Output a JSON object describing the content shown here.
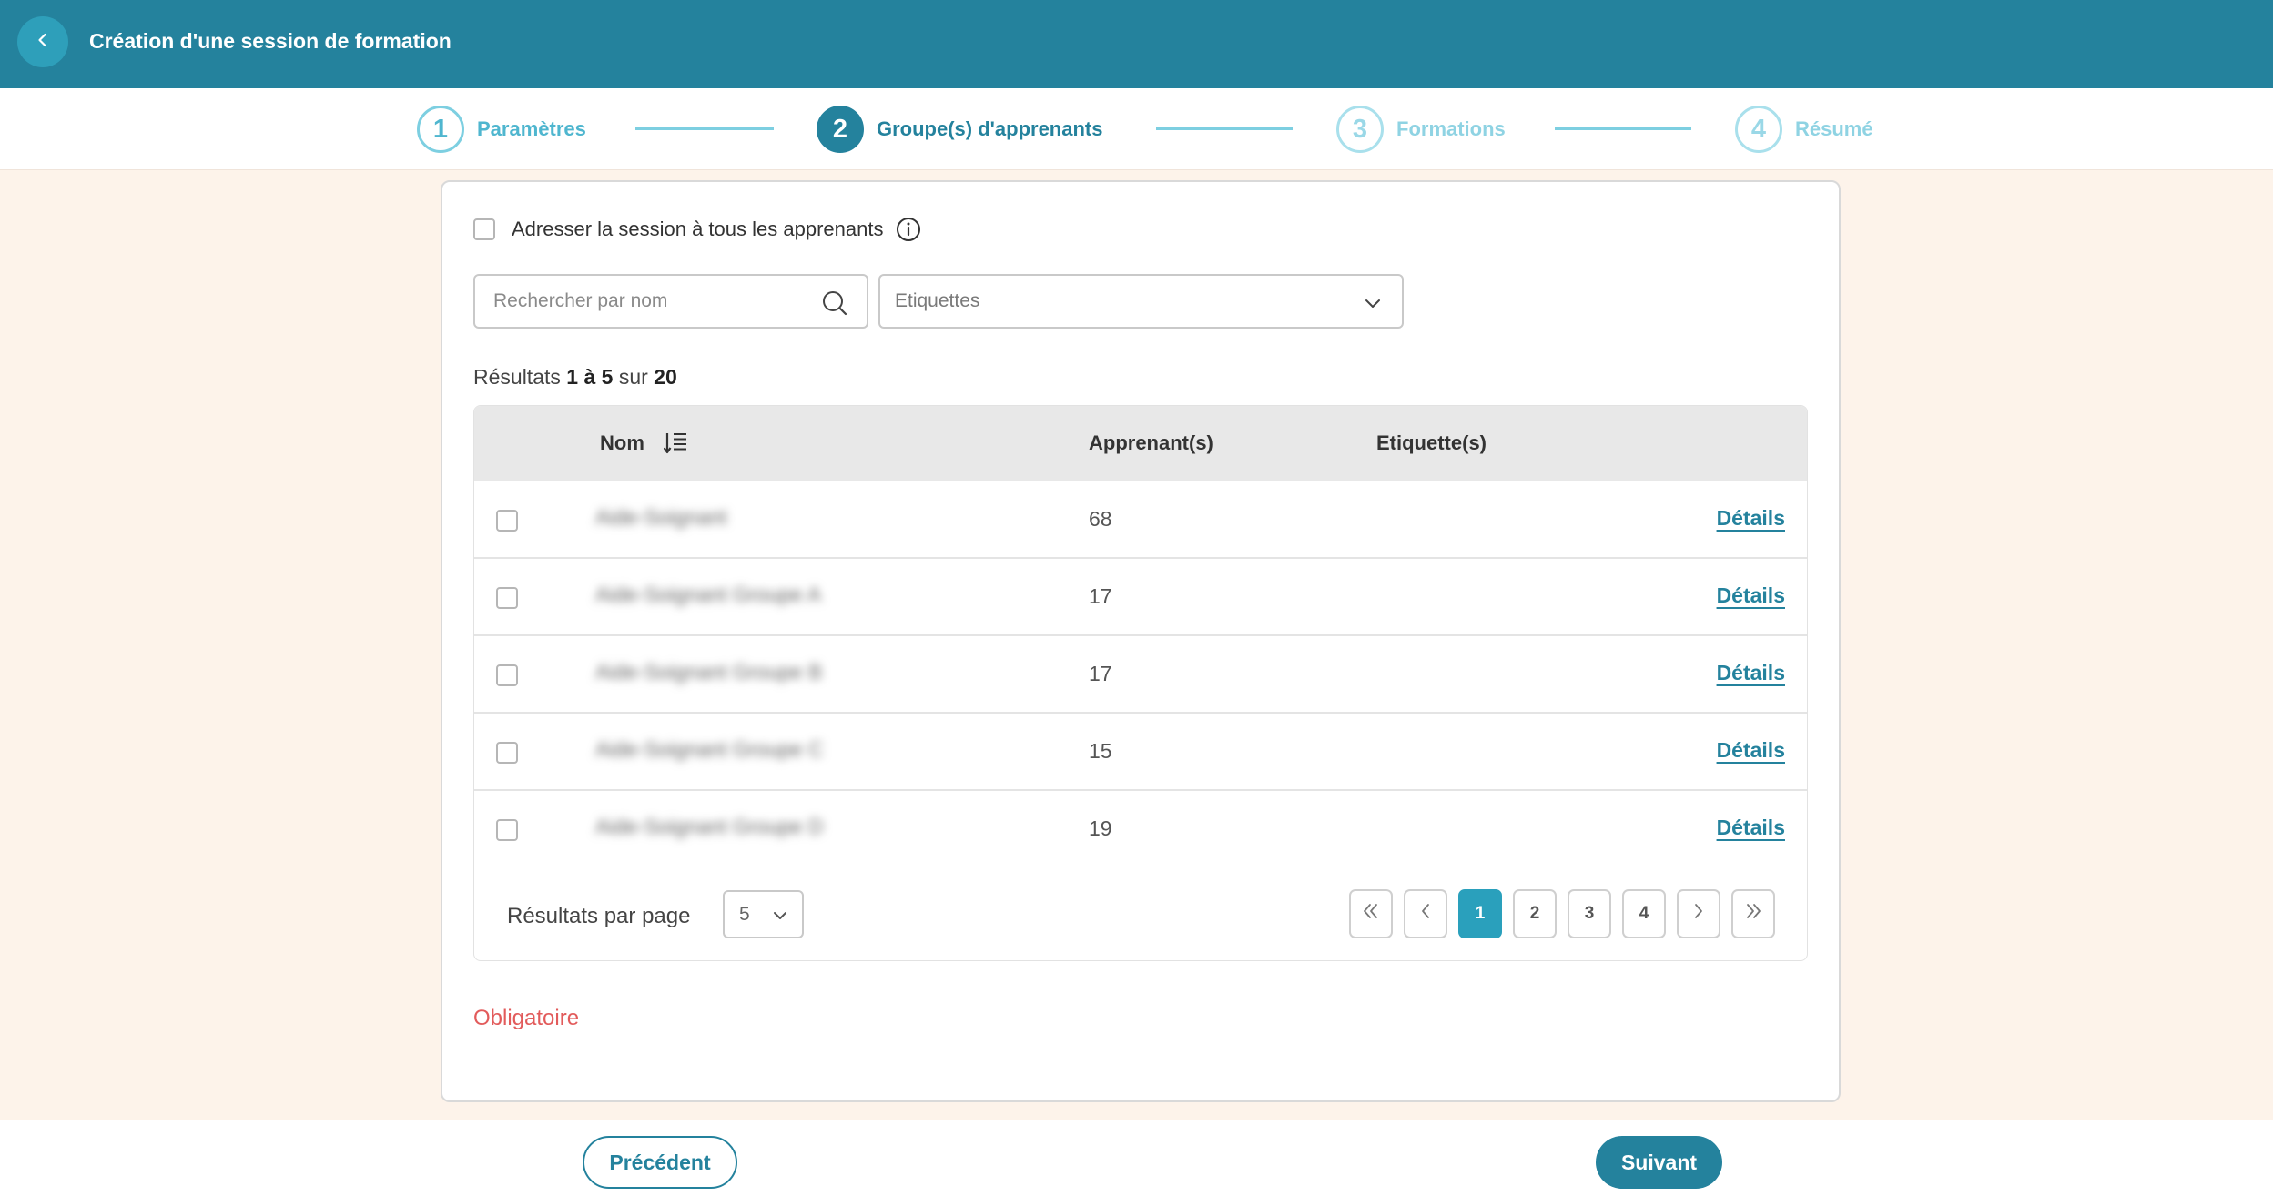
{
  "header": {
    "title": "Création d'une session de formation",
    "back_icon": "chevron-left-icon"
  },
  "stepper": {
    "steps": [
      {
        "number": "1",
        "label": "Paramètres",
        "state": "done"
      },
      {
        "number": "2",
        "label": "Groupe(s) d'apprenants",
        "state": "active"
      },
      {
        "number": "3",
        "label": "Formations",
        "state": "todo"
      },
      {
        "number": "4",
        "label": "Résumé",
        "state": "todo"
      }
    ]
  },
  "form": {
    "all_learners_label": "Adresser la session à tous les apprenants",
    "all_learners_checked": false,
    "search_placeholder": "Rechercher par nom",
    "search_value": "",
    "tags_placeholder": "Etiquettes",
    "results": {
      "prefix": "Résultats",
      "range": "1 à 5",
      "middle": "sur",
      "total": "20"
    },
    "required_message": "Obligatoire"
  },
  "table": {
    "headers": {
      "name": "Nom",
      "learners": "Apprenant(s)",
      "tags": "Etiquette(s)"
    },
    "rows": [
      {
        "name": "Aide-Soignant",
        "learners": "68",
        "tags": "",
        "action": "Détails"
      },
      {
        "name": "Aide-Soignant Groupe A",
        "learners": "17",
        "tags": "",
        "action": "Détails"
      },
      {
        "name": "Aide-Soignant Groupe B",
        "learners": "17",
        "tags": "",
        "action": "Détails"
      },
      {
        "name": "Aide-Soignant Groupe C",
        "learners": "15",
        "tags": "",
        "action": "Détails"
      },
      {
        "name": "Aide-Soignant Groupe D",
        "learners": "19",
        "tags": "",
        "action": "Détails"
      }
    ],
    "per_page_label": "Résultats par page",
    "per_page_value": "5",
    "pages": [
      "1",
      "2",
      "3",
      "4"
    ],
    "current_page": "1"
  },
  "footer": {
    "prev_label": "Précédent",
    "next_label": "Suivant"
  },
  "colors": {
    "primary": "#24829d",
    "accent": "#2aa0bc",
    "background": "#fdf3ea",
    "error": "#e25b5b"
  }
}
